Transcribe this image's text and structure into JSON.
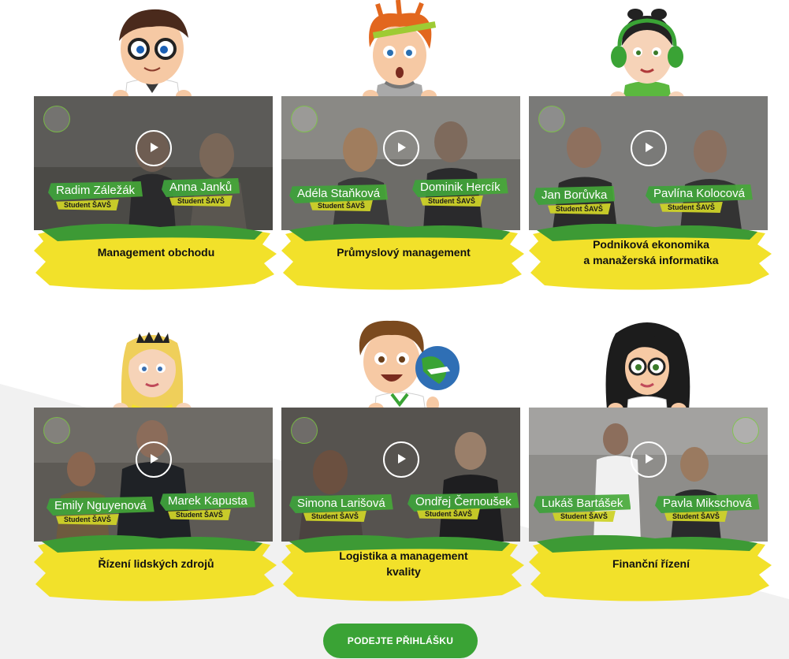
{
  "colors": {
    "accent_green": "#3aa335",
    "brush_yellow": "#f2e12a",
    "brush_green": "#3d9a35"
  },
  "videos": [
    {
      "course": "Management obchodu",
      "student_left": "Radim Záležák",
      "student_right": "Anna Janků",
      "role": "Student ŠAVŠ",
      "mascot": "boy-glasses-mascot"
    },
    {
      "course": "Průmyslový management",
      "student_left": "Adéla Staňková",
      "student_right": "Dominik Hercík",
      "role": "Student ŠAVŠ",
      "mascot": "redhead-ruler-mascot"
    },
    {
      "course_line1": "Podniková ekonomika",
      "course_line2": "a manažerská informatika",
      "student_left": "Jan Borůvka",
      "student_right": "Pavlína Kolocová",
      "role": "Student ŠAVŠ",
      "mascot": "girl-headphones-mascot"
    },
    {
      "course": "Řízení lidských zdrojů",
      "student_left": "Emily Nguyenová",
      "student_right": "Marek Kapusta",
      "role": "Student ŠAVŠ",
      "mascot": "blonde-crown-mascot"
    },
    {
      "course_line1": "Logistika a management",
      "course_line2": "kvality",
      "student_left": "Simona Larišová",
      "student_right": "Ondřej Černoušek",
      "role": "Student ŠAVŠ",
      "mascot": "boy-globe-mascot"
    },
    {
      "course": "Finanční řízení",
      "student_left": "Lukáš Bartášek",
      "student_right": "Pavla Mikschová",
      "role": "Student ŠAVŠ",
      "mascot": "girl-dark-hair-mascot"
    }
  ],
  "cta": {
    "label": "PODEJTE PŘIHLÁŠKU"
  }
}
